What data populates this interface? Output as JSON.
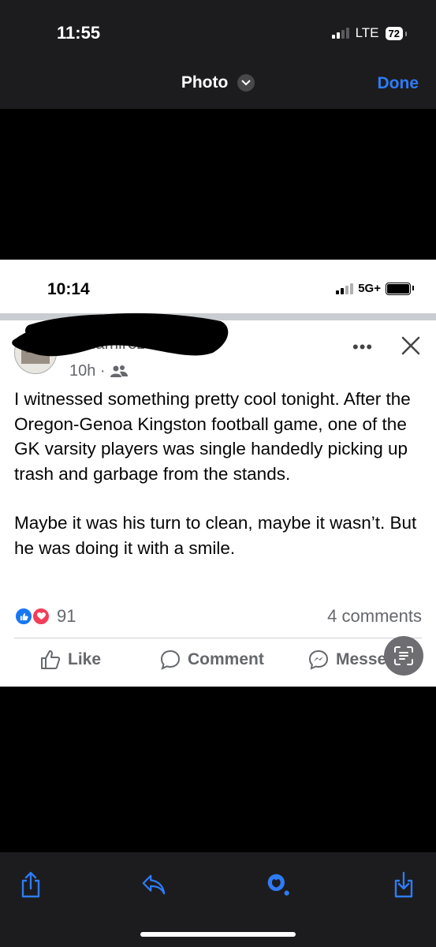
{
  "outer_status": {
    "time": "11:55",
    "network": "LTE",
    "battery": "72"
  },
  "viewer": {
    "title": "Photo",
    "done_label": "Done"
  },
  "inner_status": {
    "time": "10:14",
    "network": "5G+"
  },
  "post": {
    "author_visible": "S Ramirez",
    "time_ago": "10h ·",
    "paragraphs": [
      "I witnessed something pretty cool tonight. After the Oregon-Genoa Kingston football game, one of the GK varsity players was single handedly picking up trash and garbage from the stands.",
      "Maybe it was his turn to clean, maybe it wasn’t. But he was doing it with a smile."
    ],
    "reaction_count": "91",
    "comments": "4 comments"
  },
  "actions": {
    "like": "Like",
    "comment": "Comment",
    "message": "Messenger"
  },
  "colors": {
    "accent": "#2f7bf6",
    "fb_blue": "#1877f2",
    "love_red": "#f33e58"
  },
  "icons": [
    "signal-icon",
    "battery-icon",
    "chevron-down-icon",
    "more-icon",
    "close-icon",
    "like-icon",
    "comment-icon",
    "messenger-icon",
    "lens-icon",
    "share-icon",
    "reply-icon",
    "visual-lookup-icon",
    "save-icon"
  ]
}
